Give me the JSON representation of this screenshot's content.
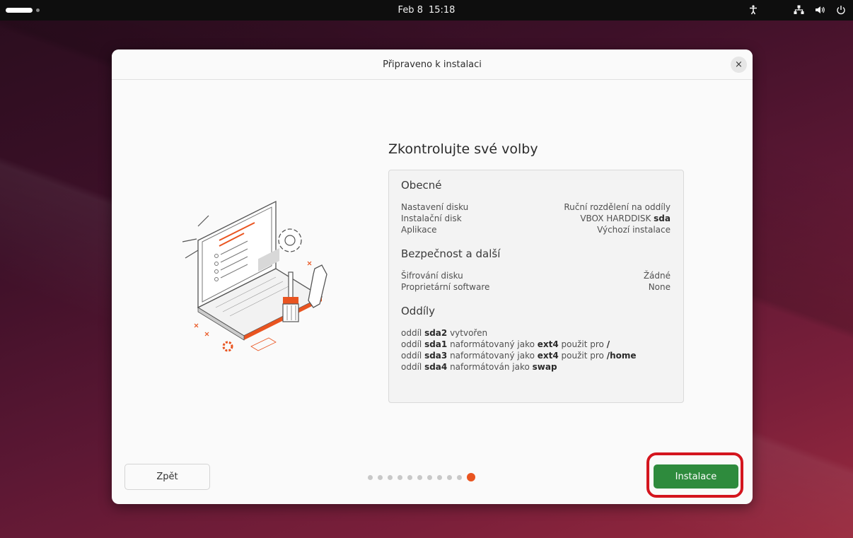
{
  "topbar": {
    "date": "Feb 8",
    "time": "15:18",
    "icons": [
      "accessibility-icon",
      "network-icon",
      "volume-icon",
      "power-icon"
    ]
  },
  "dialog": {
    "title": "Připraveno k instalaci",
    "close_label": "×",
    "heading": "Zkontrolujte své volby",
    "general": {
      "title": "Obecné",
      "rows": [
        {
          "label": "Nastavení disku",
          "value": "Ruční rozdělení na oddíly",
          "value_bold": ""
        },
        {
          "label": "Instalační disk",
          "value": "VBOX HARDDISK ",
          "value_bold": "sda"
        },
        {
          "label": "Aplikace",
          "value": "Výchozí instalace",
          "value_bold": ""
        }
      ]
    },
    "security": {
      "title": "Bezpečnost a další",
      "rows": [
        {
          "label": "Šifrování disku",
          "value": "Žádné"
        },
        {
          "label": "Proprietární software",
          "value": "None"
        }
      ]
    },
    "partitions": {
      "title": "Oddíly",
      "lines": [
        {
          "p1": "oddíl ",
          "b1": "sda2",
          "p2": " vytvořen",
          "b2": "",
          "p3": "",
          "b3": ""
        },
        {
          "p1": "oddíl ",
          "b1": "sda1",
          "p2": " naformátovaný jako ",
          "b2": "ext4",
          "p3": " použit pro ",
          "b3": "/"
        },
        {
          "p1": "oddíl ",
          "b1": "sda3",
          "p2": " naformátovaný jako ",
          "b2": "ext4",
          "p3": " použit pro ",
          "b3": "/home"
        },
        {
          "p1": "oddíl ",
          "b1": "sda4",
          "p2": " naformátován jako ",
          "b2": "swap",
          "p3": "",
          "b3": ""
        }
      ]
    },
    "back_label": "Zpět",
    "install_label": "Instalace",
    "page_indicator": {
      "total": 11,
      "current": 11
    }
  },
  "colors": {
    "accent": "#e95420",
    "install_green": "#2e8b3d",
    "highlight_red": "#d4151e"
  }
}
